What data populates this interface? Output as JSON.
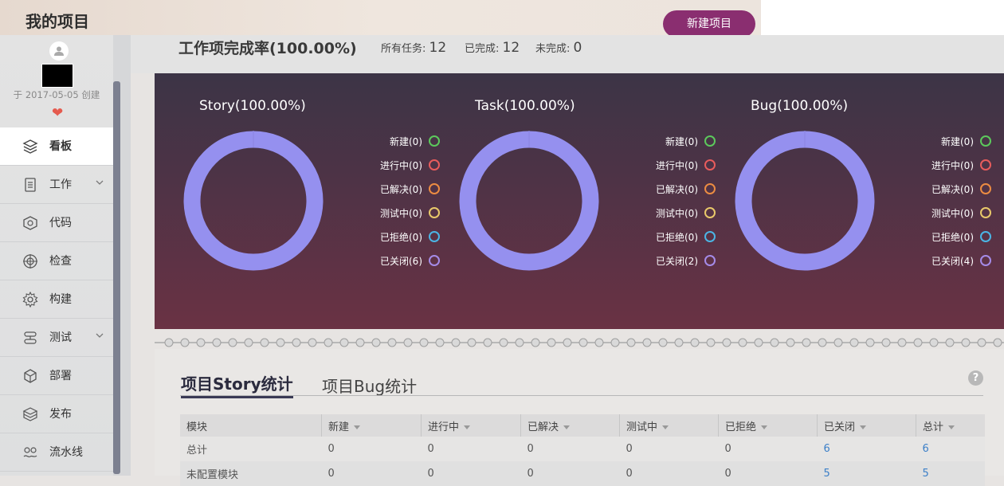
{
  "header": {
    "title": "我的项目",
    "new_project_label": "新建项目"
  },
  "profile": {
    "created_text": "于 2017-05-05 创建"
  },
  "sidebar": {
    "items": [
      {
        "label": "看板",
        "icon": "layers-icon",
        "active": true
      },
      {
        "label": "工作",
        "icon": "document-list-icon",
        "expandable": true
      },
      {
        "label": "代码",
        "icon": "code-shield-icon"
      },
      {
        "label": "检查",
        "icon": "target-icon"
      },
      {
        "label": "构建",
        "icon": "gear-icon"
      },
      {
        "label": "测试",
        "icon": "test-flow-icon",
        "expandable": true
      },
      {
        "label": "部署",
        "icon": "cube-icon"
      },
      {
        "label": "发布",
        "icon": "package-icon"
      },
      {
        "label": "流水线",
        "icon": "pipeline-icon"
      }
    ]
  },
  "summary": {
    "rate_title": "工作项完成率(100.00%)",
    "all_label": "所有任务:",
    "all_value": "12",
    "done_label": "已完成:",
    "done_value": "12",
    "undone_label": "未完成:",
    "undone_value": "0"
  },
  "colors": {
    "ring": "#9590ef",
    "new": "#5cc95c",
    "in_progress": "#e85c5c",
    "resolved": "#ec8c42",
    "testing": "#e9c96a",
    "rejected": "#4bb5e5",
    "closed": "#a58be8"
  },
  "charts": [
    {
      "title": "Story(100.00%)",
      "legend": [
        "新建(0)",
        "进行中(0)",
        "已解决(0)",
        "测试中(0)",
        "已拒绝(0)",
        "已关闭(6)"
      ]
    },
    {
      "title": "Task(100.00%)",
      "legend": [
        "新建(0)",
        "进行中(0)",
        "已解决(0)",
        "测试中(0)",
        "已拒绝(0)",
        "已关闭(2)"
      ]
    },
    {
      "title": "Bug(100.00%)",
      "legend": [
        "新建(0)",
        "进行中(0)",
        "已解决(0)",
        "测试中(0)",
        "已拒绝(0)",
        "已关闭(4)"
      ]
    }
  ],
  "chart_data": [
    {
      "type": "pie",
      "title": "Story(100.00%)",
      "categories": [
        "新建",
        "进行中",
        "已解决",
        "测试中",
        "已拒绝",
        "已关闭"
      ],
      "values": [
        0,
        0,
        0,
        0,
        0,
        6
      ]
    },
    {
      "type": "pie",
      "title": "Task(100.00%)",
      "categories": [
        "新建",
        "进行中",
        "已解决",
        "测试中",
        "已拒绝",
        "已关闭"
      ],
      "values": [
        0,
        0,
        0,
        0,
        0,
        2
      ]
    },
    {
      "type": "pie",
      "title": "Bug(100.00%)",
      "categories": [
        "新建",
        "进行中",
        "已解决",
        "测试中",
        "已拒绝",
        "已关闭"
      ],
      "values": [
        0,
        0,
        0,
        0,
        0,
        4
      ]
    }
  ],
  "tabs": [
    {
      "label": "项目Story统计",
      "active": true
    },
    {
      "label": "项目Bug统计",
      "active": false
    }
  ],
  "help_label": "?",
  "table": {
    "columns": [
      "模块",
      "新建",
      "进行中",
      "已解决",
      "测试中",
      "已拒绝",
      "已关闭",
      "总计"
    ],
    "rows": [
      [
        "总计",
        "0",
        "0",
        "0",
        "0",
        "0",
        "6",
        "6"
      ],
      [
        "未配置模块",
        "0",
        "0",
        "0",
        "0",
        "0",
        "5",
        "5"
      ]
    ]
  }
}
